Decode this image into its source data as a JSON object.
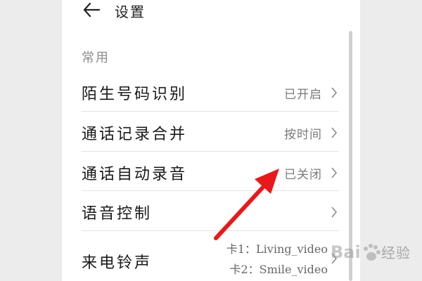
{
  "header": {
    "title": "设置"
  },
  "section": {
    "title": "常用"
  },
  "rows": [
    {
      "label": "陌生号码识别",
      "value": "已开启"
    },
    {
      "label": "通话记录合并",
      "value": "按时间"
    },
    {
      "label": "通话自动录音",
      "value": "已关闭"
    },
    {
      "label": "语音控制",
      "value": ""
    },
    {
      "label": "来电铃声",
      "lines": [
        "卡1：Living_video",
        "卡2：Smile_video"
      ]
    }
  ],
  "watermark": {
    "text": "Bai 经验"
  },
  "icons": {
    "back": "arrow-left-icon",
    "chevron": "chevron-right-icon",
    "pointer": "red-arrow-icon"
  },
  "colors": {
    "annotation_arrow": "#e8191b"
  }
}
